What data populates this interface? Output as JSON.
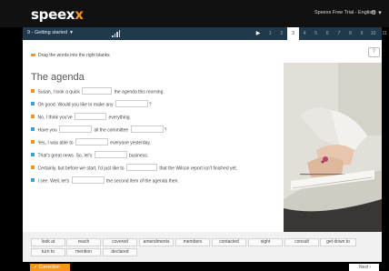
{
  "app": {
    "logo_main": "speex",
    "logo_accent": "x"
  },
  "topbar": {
    "trial_text": "Speexx Free Trial - English",
    "settings_icon": "⚙ ▾"
  },
  "nav": {
    "lesson_label": "9 - Getting started",
    "pages": [
      "1",
      "2",
      "3",
      "4",
      "5",
      "6",
      "7",
      "8",
      "9",
      "10",
      "11"
    ],
    "active_page": "3"
  },
  "exercise": {
    "instruction": "Drag the words into the right blanks",
    "help": "?",
    "title": "The agenda",
    "sentences": [
      {
        "parts": [
          "Susan, I took a quick",
          "the agenda this morning."
        ],
        "bullet": "orange"
      },
      {
        "parts": [
          "Oh good.  Would you like to make any",
          "?"
        ],
        "bullet": "blue"
      },
      {
        "parts": [
          "No, I think you've",
          "everything."
        ],
        "bullet": "orange"
      },
      {
        "parts": [
          "Have you",
          "all the committee",
          "?"
        ],
        "bullet": "blue"
      },
      {
        "parts": [
          "Yes, I was able to",
          "everyone yesterday."
        ],
        "bullet": "orange"
      },
      {
        "parts": [
          "That's great news.  So, let's",
          "business."
        ],
        "bullet": "blue"
      },
      {
        "parts": [
          "Certainly, but before we start, I'd just like to",
          "that the Wilson report isn't finished yet."
        ],
        "bullet": "orange"
      },
      {
        "parts": [
          "I see.  Well, let's",
          "the second item of the agenda then."
        ],
        "bullet": "blue"
      }
    ]
  },
  "words": [
    "look at",
    "reach",
    "covered",
    "amendments",
    "members",
    "contacted",
    "sight",
    "consult",
    "get down to",
    "turn to",
    "mention",
    "declared"
  ],
  "footer": {
    "correction_label": "Correction",
    "next_label": "Next"
  },
  "colors": {
    "accent": "#f7941d",
    "nav_bg": "#1e3a4c",
    "bullet_blue": "#3aa0d8"
  }
}
